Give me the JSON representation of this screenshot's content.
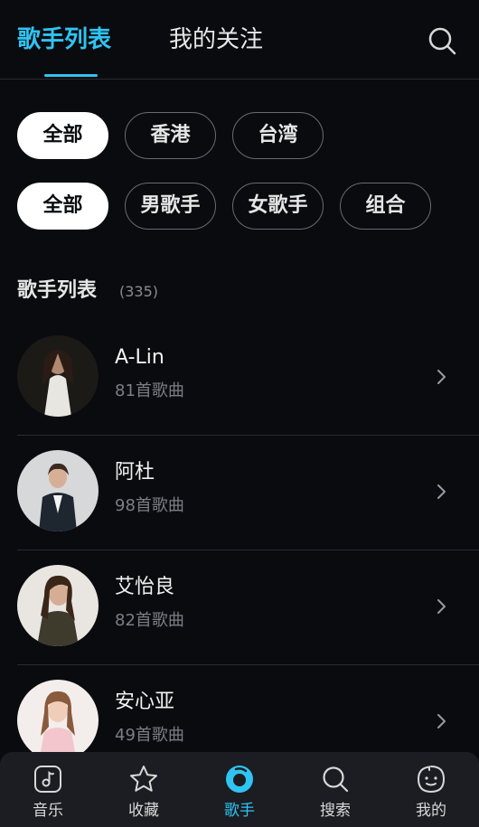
{
  "header": {
    "tabs": [
      {
        "label": "歌手列表"
      },
      {
        "label": "我的关注"
      }
    ]
  },
  "filters": {
    "region": [
      "全部",
      "香港",
      "台湾"
    ],
    "type": [
      "全部",
      "男歌手",
      "女歌手",
      "组合"
    ]
  },
  "section": {
    "title": "歌手列表",
    "count": "(335)"
  },
  "artists": [
    {
      "name": "A-Lin",
      "songs": "81首歌曲"
    },
    {
      "name": "阿杜",
      "songs": "98首歌曲"
    },
    {
      "name": "艾怡良",
      "songs": "82首歌曲"
    },
    {
      "name": "安心亚",
      "songs": "49首歌曲"
    }
  ],
  "nav": [
    {
      "label": "音乐",
      "icon": "music-icon"
    },
    {
      "label": "收藏",
      "icon": "star-icon"
    },
    {
      "label": "歌手",
      "icon": "singer-icon"
    },
    {
      "label": "搜索",
      "icon": "search-icon"
    },
    {
      "label": "我的",
      "icon": "profile-icon"
    }
  ],
  "colors": {
    "accent": "#2fc4f2",
    "background": "#0a0b0f",
    "nav_background": "#1b1d22"
  }
}
